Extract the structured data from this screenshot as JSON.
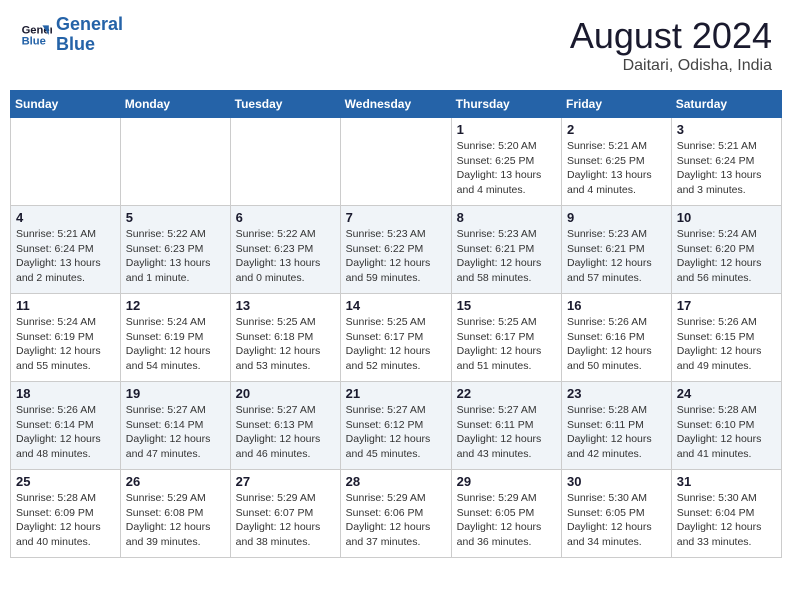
{
  "header": {
    "logo_line1": "General",
    "logo_line2": "Blue",
    "month": "August 2024",
    "location": "Daitari, Odisha, India"
  },
  "weekdays": [
    "Sunday",
    "Monday",
    "Tuesday",
    "Wednesday",
    "Thursday",
    "Friday",
    "Saturday"
  ],
  "weeks": [
    [
      {
        "day": "",
        "info": ""
      },
      {
        "day": "",
        "info": ""
      },
      {
        "day": "",
        "info": ""
      },
      {
        "day": "",
        "info": ""
      },
      {
        "day": "1",
        "info": "Sunrise: 5:20 AM\nSunset: 6:25 PM\nDaylight: 13 hours\nand 4 minutes."
      },
      {
        "day": "2",
        "info": "Sunrise: 5:21 AM\nSunset: 6:25 PM\nDaylight: 13 hours\nand 4 minutes."
      },
      {
        "day": "3",
        "info": "Sunrise: 5:21 AM\nSunset: 6:24 PM\nDaylight: 13 hours\nand 3 minutes."
      }
    ],
    [
      {
        "day": "4",
        "info": "Sunrise: 5:21 AM\nSunset: 6:24 PM\nDaylight: 13 hours\nand 2 minutes."
      },
      {
        "day": "5",
        "info": "Sunrise: 5:22 AM\nSunset: 6:23 PM\nDaylight: 13 hours\nand 1 minute."
      },
      {
        "day": "6",
        "info": "Sunrise: 5:22 AM\nSunset: 6:23 PM\nDaylight: 13 hours\nand 0 minutes."
      },
      {
        "day": "7",
        "info": "Sunrise: 5:23 AM\nSunset: 6:22 PM\nDaylight: 12 hours\nand 59 minutes."
      },
      {
        "day": "8",
        "info": "Sunrise: 5:23 AM\nSunset: 6:21 PM\nDaylight: 12 hours\nand 58 minutes."
      },
      {
        "day": "9",
        "info": "Sunrise: 5:23 AM\nSunset: 6:21 PM\nDaylight: 12 hours\nand 57 minutes."
      },
      {
        "day": "10",
        "info": "Sunrise: 5:24 AM\nSunset: 6:20 PM\nDaylight: 12 hours\nand 56 minutes."
      }
    ],
    [
      {
        "day": "11",
        "info": "Sunrise: 5:24 AM\nSunset: 6:19 PM\nDaylight: 12 hours\nand 55 minutes."
      },
      {
        "day": "12",
        "info": "Sunrise: 5:24 AM\nSunset: 6:19 PM\nDaylight: 12 hours\nand 54 minutes."
      },
      {
        "day": "13",
        "info": "Sunrise: 5:25 AM\nSunset: 6:18 PM\nDaylight: 12 hours\nand 53 minutes."
      },
      {
        "day": "14",
        "info": "Sunrise: 5:25 AM\nSunset: 6:17 PM\nDaylight: 12 hours\nand 52 minutes."
      },
      {
        "day": "15",
        "info": "Sunrise: 5:25 AM\nSunset: 6:17 PM\nDaylight: 12 hours\nand 51 minutes."
      },
      {
        "day": "16",
        "info": "Sunrise: 5:26 AM\nSunset: 6:16 PM\nDaylight: 12 hours\nand 50 minutes."
      },
      {
        "day": "17",
        "info": "Sunrise: 5:26 AM\nSunset: 6:15 PM\nDaylight: 12 hours\nand 49 minutes."
      }
    ],
    [
      {
        "day": "18",
        "info": "Sunrise: 5:26 AM\nSunset: 6:14 PM\nDaylight: 12 hours\nand 48 minutes."
      },
      {
        "day": "19",
        "info": "Sunrise: 5:27 AM\nSunset: 6:14 PM\nDaylight: 12 hours\nand 47 minutes."
      },
      {
        "day": "20",
        "info": "Sunrise: 5:27 AM\nSunset: 6:13 PM\nDaylight: 12 hours\nand 46 minutes."
      },
      {
        "day": "21",
        "info": "Sunrise: 5:27 AM\nSunset: 6:12 PM\nDaylight: 12 hours\nand 45 minutes."
      },
      {
        "day": "22",
        "info": "Sunrise: 5:27 AM\nSunset: 6:11 PM\nDaylight: 12 hours\nand 43 minutes."
      },
      {
        "day": "23",
        "info": "Sunrise: 5:28 AM\nSunset: 6:11 PM\nDaylight: 12 hours\nand 42 minutes."
      },
      {
        "day": "24",
        "info": "Sunrise: 5:28 AM\nSunset: 6:10 PM\nDaylight: 12 hours\nand 41 minutes."
      }
    ],
    [
      {
        "day": "25",
        "info": "Sunrise: 5:28 AM\nSunset: 6:09 PM\nDaylight: 12 hours\nand 40 minutes."
      },
      {
        "day": "26",
        "info": "Sunrise: 5:29 AM\nSunset: 6:08 PM\nDaylight: 12 hours\nand 39 minutes."
      },
      {
        "day": "27",
        "info": "Sunrise: 5:29 AM\nSunset: 6:07 PM\nDaylight: 12 hours\nand 38 minutes."
      },
      {
        "day": "28",
        "info": "Sunrise: 5:29 AM\nSunset: 6:06 PM\nDaylight: 12 hours\nand 37 minutes."
      },
      {
        "day": "29",
        "info": "Sunrise: 5:29 AM\nSunset: 6:05 PM\nDaylight: 12 hours\nand 36 minutes."
      },
      {
        "day": "30",
        "info": "Sunrise: 5:30 AM\nSunset: 6:05 PM\nDaylight: 12 hours\nand 34 minutes."
      },
      {
        "day": "31",
        "info": "Sunrise: 5:30 AM\nSunset: 6:04 PM\nDaylight: 12 hours\nand 33 minutes."
      }
    ]
  ]
}
